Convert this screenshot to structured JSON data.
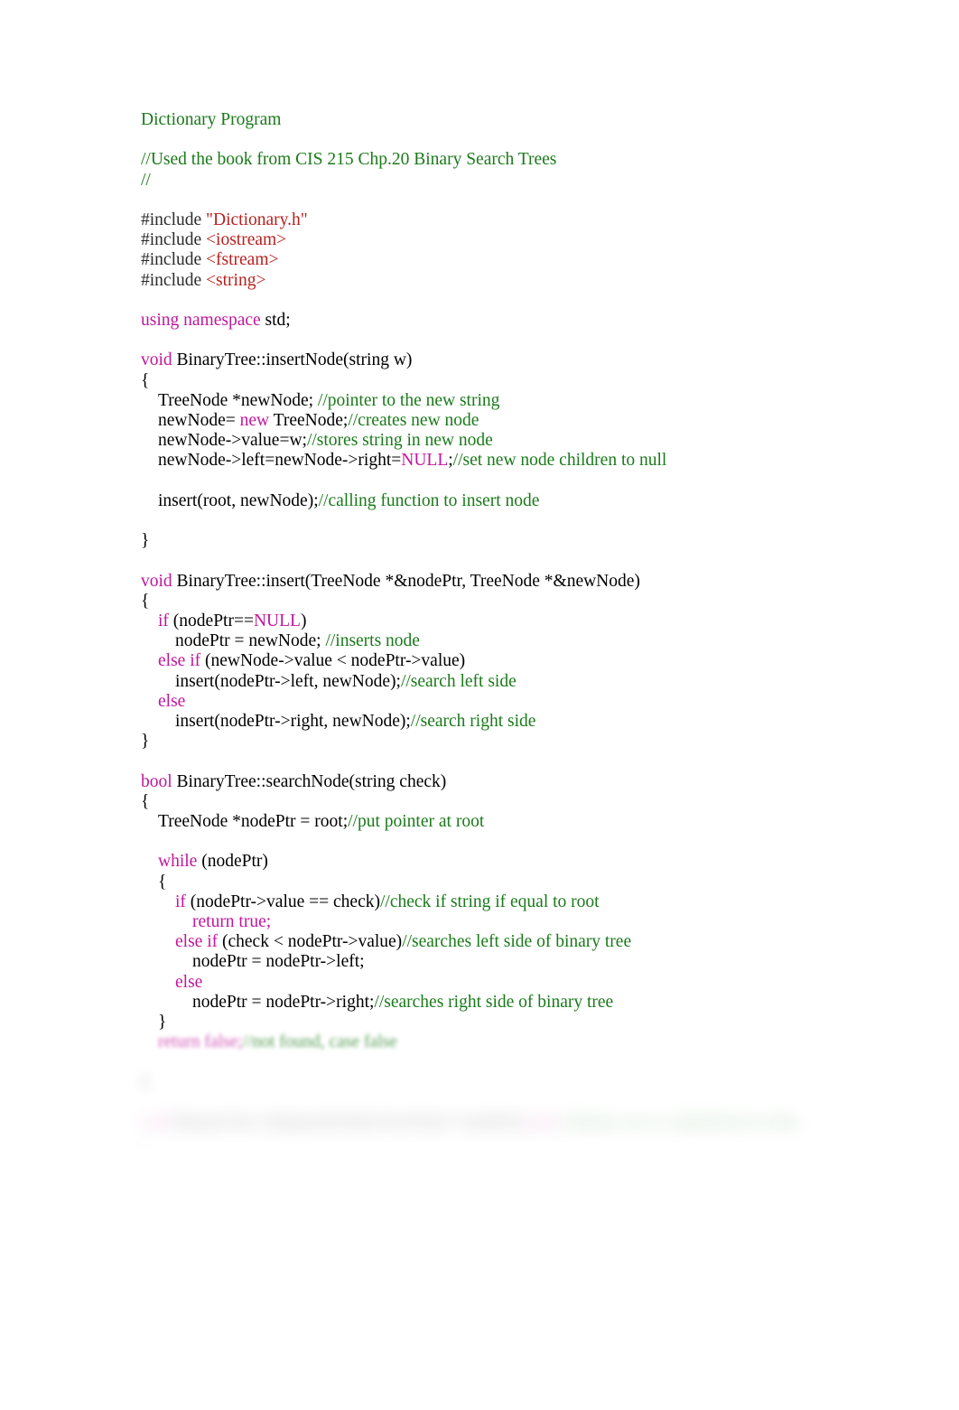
{
  "document": {
    "title": "Dictionary Program",
    "page_background": "#ffffff",
    "colors": {
      "comment": "#1a7a1a",
      "keyword": "#c0179c",
      "string": "#b5221f",
      "plain": "#000000",
      "preprocessor": "#2b2b2b"
    }
  },
  "lines": [
    {
      "id": "l1",
      "indent": 0,
      "blur": 0,
      "tokens": [
        {
          "t": "Dictionary Program",
          "c": "comment"
        }
      ]
    },
    {
      "id": "l2",
      "indent": 0,
      "blur": 0,
      "tokens": []
    },
    {
      "id": "l3",
      "indent": 0,
      "blur": 0,
      "tokens": [
        {
          "t": "//Used the book from CIS 215 Chp.20 Binary Search Trees",
          "c": "comment"
        }
      ]
    },
    {
      "id": "l4",
      "indent": 0,
      "blur": 0,
      "tokens": [
        {
          "t": "//",
          "c": "comment"
        }
      ]
    },
    {
      "id": "l5",
      "indent": 0,
      "blur": 0,
      "tokens": []
    },
    {
      "id": "l6",
      "indent": 0,
      "blur": 0,
      "tokens": [
        {
          "t": "#include ",
          "c": "preproc"
        },
        {
          "t": "\"Dictionary.h\"",
          "c": "string"
        }
      ]
    },
    {
      "id": "l7",
      "indent": 0,
      "blur": 0,
      "tokens": [
        {
          "t": "#include ",
          "c": "preproc"
        },
        {
          "t": "<iostream>",
          "c": "string"
        }
      ]
    },
    {
      "id": "l8",
      "indent": 0,
      "blur": 0,
      "tokens": [
        {
          "t": "#include ",
          "c": "preproc"
        },
        {
          "t": "<fstream>",
          "c": "string"
        }
      ]
    },
    {
      "id": "l9",
      "indent": 0,
      "blur": 0,
      "tokens": [
        {
          "t": "#include ",
          "c": "preproc"
        },
        {
          "t": "<string>",
          "c": "string"
        }
      ]
    },
    {
      "id": "l10",
      "indent": 0,
      "blur": 0,
      "tokens": []
    },
    {
      "id": "l11",
      "indent": 0,
      "blur": 0,
      "tokens": [
        {
          "t": "using namespace",
          "c": "keyword"
        },
        {
          "t": " std;",
          "c": "plain"
        }
      ]
    },
    {
      "id": "l12",
      "indent": 0,
      "blur": 0,
      "tokens": []
    },
    {
      "id": "l13",
      "indent": 0,
      "blur": 0,
      "tokens": [
        {
          "t": "void",
          "c": "keyword"
        },
        {
          "t": " BinaryTree::insertNode(string w)",
          "c": "plain"
        }
      ]
    },
    {
      "id": "l14",
      "indent": 0,
      "blur": 0,
      "tokens": [
        {
          "t": "{",
          "c": "plain"
        }
      ]
    },
    {
      "id": "l15",
      "indent": 1,
      "blur": 0,
      "tokens": [
        {
          "t": "TreeNode *newNode; ",
          "c": "plain"
        },
        {
          "t": "//pointer to the new string",
          "c": "comment"
        }
      ]
    },
    {
      "id": "l16",
      "indent": 1,
      "blur": 0,
      "tokens": [
        {
          "t": "newNode= ",
          "c": "plain"
        },
        {
          "t": "new",
          "c": "keyword"
        },
        {
          "t": " TreeNode;",
          "c": "plain"
        },
        {
          "t": "//creates new node",
          "c": "comment"
        }
      ]
    },
    {
      "id": "l17",
      "indent": 1,
      "blur": 0,
      "tokens": [
        {
          "t": "newNode->value=w;",
          "c": "plain"
        },
        {
          "t": "//stores string in new node",
          "c": "comment"
        }
      ]
    },
    {
      "id": "l18",
      "indent": 1,
      "blur": 0,
      "tokens": [
        {
          "t": "newNode->left=newNode->right=",
          "c": "plain"
        },
        {
          "t": "NULL",
          "c": "keyword"
        },
        {
          "t": ";",
          "c": "plain"
        },
        {
          "t": "//set new node children to null",
          "c": "comment"
        }
      ]
    },
    {
      "id": "l19",
      "indent": 0,
      "blur": 0,
      "tokens": []
    },
    {
      "id": "l20",
      "indent": 1,
      "blur": 0,
      "tokens": [
        {
          "t": "insert(root, newNode);",
          "c": "plain"
        },
        {
          "t": "//calling function to insert node",
          "c": "comment"
        }
      ]
    },
    {
      "id": "l21",
      "indent": 0,
      "blur": 0,
      "tokens": []
    },
    {
      "id": "l22",
      "indent": 0,
      "blur": 0,
      "tokens": [
        {
          "t": "}",
          "c": "plain"
        }
      ]
    },
    {
      "id": "l23",
      "indent": 0,
      "blur": 0,
      "tokens": []
    },
    {
      "id": "l24",
      "indent": 0,
      "blur": 0,
      "tokens": [
        {
          "t": "void",
          "c": "keyword"
        },
        {
          "t": " BinaryTree::insert(TreeNode *&nodePtr, TreeNode *&newNode)",
          "c": "plain"
        }
      ]
    },
    {
      "id": "l25",
      "indent": 0,
      "blur": 0,
      "tokens": [
        {
          "t": "{",
          "c": "plain"
        }
      ]
    },
    {
      "id": "l26",
      "indent": 1,
      "blur": 0,
      "tokens": [
        {
          "t": "if",
          "c": "keyword"
        },
        {
          "t": " (nodePtr==",
          "c": "plain"
        },
        {
          "t": "NULL",
          "c": "keyword"
        },
        {
          "t": ")",
          "c": "plain"
        }
      ]
    },
    {
      "id": "l27",
      "indent": 2,
      "blur": 0,
      "tokens": [
        {
          "t": "nodePtr = newNode; ",
          "c": "plain"
        },
        {
          "t": "//inserts node",
          "c": "comment"
        }
      ]
    },
    {
      "id": "l28",
      "indent": 1,
      "blur": 0,
      "tokens": [
        {
          "t": "else if",
          "c": "keyword"
        },
        {
          "t": " (newNode->value < nodePtr->value)",
          "c": "plain"
        }
      ]
    },
    {
      "id": "l29",
      "indent": 2,
      "blur": 0,
      "tokens": [
        {
          "t": "insert(nodePtr->left, newNode);",
          "c": "plain"
        },
        {
          "t": "//search left side",
          "c": "comment"
        }
      ]
    },
    {
      "id": "l30",
      "indent": 1,
      "blur": 0,
      "tokens": [
        {
          "t": "else",
          "c": "keyword"
        }
      ]
    },
    {
      "id": "l31",
      "indent": 2,
      "blur": 0,
      "tokens": [
        {
          "t": "insert(nodePtr->right, newNode);",
          "c": "plain"
        },
        {
          "t": "//search right side",
          "c": "comment"
        }
      ]
    },
    {
      "id": "l32",
      "indent": 0,
      "blur": 0,
      "tokens": [
        {
          "t": "}",
          "c": "plain"
        }
      ]
    },
    {
      "id": "l33",
      "indent": 0,
      "blur": 0,
      "tokens": []
    },
    {
      "id": "l34",
      "indent": 0,
      "blur": 0,
      "tokens": [
        {
          "t": "bool",
          "c": "keyword"
        },
        {
          "t": " BinaryTree::searchNode(string check)",
          "c": "plain"
        }
      ]
    },
    {
      "id": "l35",
      "indent": 0,
      "blur": 0,
      "tokens": [
        {
          "t": "{",
          "c": "plain"
        }
      ]
    },
    {
      "id": "l36",
      "indent": 1,
      "blur": 0,
      "tokens": [
        {
          "t": "TreeNode *nodePtr = root;",
          "c": "plain"
        },
        {
          "t": "//put pointer at root",
          "c": "comment"
        }
      ]
    },
    {
      "id": "l37",
      "indent": 0,
      "blur": 0,
      "tokens": []
    },
    {
      "id": "l38",
      "indent": 1,
      "blur": 0,
      "tokens": [
        {
          "t": "while",
          "c": "keyword"
        },
        {
          "t": " (nodePtr)",
          "c": "plain"
        }
      ]
    },
    {
      "id": "l39",
      "indent": 1,
      "blur": 0,
      "tokens": [
        {
          "t": "{",
          "c": "plain"
        }
      ]
    },
    {
      "id": "l40",
      "indent": 2,
      "blur": 0,
      "tokens": [
        {
          "t": "if",
          "c": "keyword"
        },
        {
          "t": " (nodePtr->value == check)",
          "c": "plain"
        },
        {
          "t": "//check if string if equal to root",
          "c": "comment"
        }
      ]
    },
    {
      "id": "l41",
      "indent": 3,
      "blur": 0,
      "tokens": [
        {
          "t": "return true;",
          "c": "keyword"
        }
      ]
    },
    {
      "id": "l42",
      "indent": 2,
      "blur": 0,
      "tokens": [
        {
          "t": "else if",
          "c": "keyword"
        },
        {
          "t": " (check < nodePtr->value)",
          "c": "plain"
        },
        {
          "t": "//searches left side of binary tree",
          "c": "comment"
        }
      ]
    },
    {
      "id": "l43",
      "indent": 3,
      "blur": 0,
      "tokens": [
        {
          "t": "nodePtr = nodePtr->left;",
          "c": "plain"
        }
      ]
    },
    {
      "id": "l44",
      "indent": 2,
      "blur": 0,
      "tokens": [
        {
          "t": "else",
          "c": "keyword"
        }
      ]
    },
    {
      "id": "l45",
      "indent": 3,
      "blur": 0,
      "tokens": [
        {
          "t": "nodePtr = nodePtr->right;",
          "c": "plain"
        },
        {
          "t": "//searches right side of binary tree",
          "c": "comment"
        }
      ]
    },
    {
      "id": "l46",
      "indent": 1,
      "blur": 0,
      "tokens": [
        {
          "t": "}",
          "c": "plain"
        }
      ]
    },
    {
      "id": "l47",
      "indent": 1,
      "blur": 1,
      "tokens": [
        {
          "t": "return false;",
          "c": "keyword"
        },
        {
          "t": "//not found, case false",
          "c": "comment"
        }
      ]
    },
    {
      "id": "l48",
      "indent": 0,
      "blur": 3,
      "tokens": []
    },
    {
      "id": "l49",
      "indent": 0,
      "blur": 3,
      "tokens": [
        {
          "t": "}",
          "c": "plain"
        }
      ]
    },
    {
      "id": "l50",
      "indent": 0,
      "blur": 5,
      "tokens": []
    },
    {
      "id": "l51",
      "indent": 0,
      "blur": 4,
      "tokens": [
        {
          "t": "void",
          "c": "keyword"
        },
        {
          "t": " BinaryTree::displayInOrder(TreeNode *nodePtr)",
          "c": "plain"
        },
        {
          "t": "const",
          "c": "keyword"
        },
        {
          "t": "//display tree in alphabetical order",
          "c": "comment"
        }
      ]
    },
    {
      "id": "l52",
      "indent": 0,
      "blur": 5,
      "tokens": [
        {
          "t": "{",
          "c": "plain"
        }
      ]
    }
  ]
}
